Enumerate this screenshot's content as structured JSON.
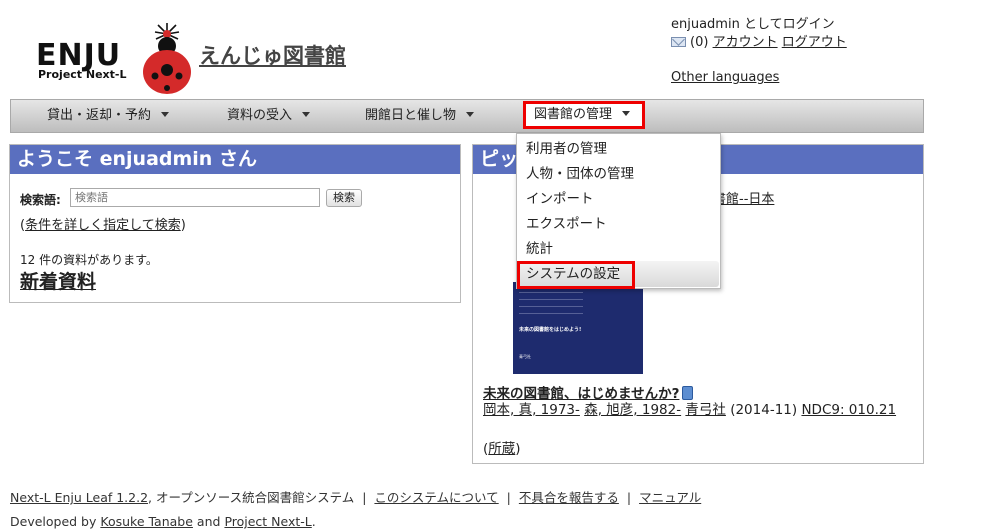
{
  "header": {
    "logo_text": "ENJU",
    "logo_sub": "Project Next-L",
    "site_title": "えんじゅ図書館",
    "login_status": "enjuadmin としてログイン",
    "message_count": "(0)",
    "account_link": "アカウント",
    "logout_link": "ログアウト",
    "other_languages": "Other languages"
  },
  "nav": {
    "items": [
      {
        "label": "貸出・返却・予約"
      },
      {
        "label": "資料の受入"
      },
      {
        "label": "開館日と催し物"
      },
      {
        "label": "図書館の管理"
      }
    ]
  },
  "dropdown": {
    "items": [
      {
        "label": "利用者の管理"
      },
      {
        "label": "人物・団体の管理"
      },
      {
        "label": "インポート"
      },
      {
        "label": "エクスポート"
      },
      {
        "label": "統計"
      },
      {
        "label": "システムの設定"
      }
    ]
  },
  "welcome": {
    "heading": "ようこそ enjuadmin さん",
    "search_label": "検索語:",
    "search_placeholder": "検索語",
    "search_button": "検索",
    "adv_open": "(",
    "adv_link": "条件を詳しく指定して検索",
    "adv_close": ")",
    "count_text": "12 件の資料があります。",
    "new_items": "新着資料"
  },
  "pickup": {
    "heading": "ピッ",
    "library_link": "書館--日本",
    "book_title": "未来の図書館、はじめませんか?",
    "author1": "岡本, 真, 1973-",
    "author2": "森, 旭彦, 1982-",
    "publisher": "青弓社",
    "pub_date": "(2014-11)",
    "ndc": "NDC9: 010.21",
    "holdings_open": "(",
    "holdings_link": "所蔵",
    "holdings_close": ")",
    "cover_title": "未来の図書館をはじめよう!",
    "cover_publisher": "青弓社"
  },
  "footer": {
    "product_link": "Next-L Enju Leaf 1.2.2",
    "product_desc": ", オープンソース統合図書館システム",
    "about_link": "このシステムについて",
    "report_link": "不具合を報告する",
    "manual_link": "マニュアル",
    "developed_by": "Developed by",
    "dev1": "Kosuke Tanabe",
    "and": "and",
    "dev2": "Project Next-L",
    "period": "."
  },
  "colors": {
    "panel_header": "#5a6fbf",
    "highlight_box": "#ee0000",
    "cover": "#1e2b6e"
  }
}
